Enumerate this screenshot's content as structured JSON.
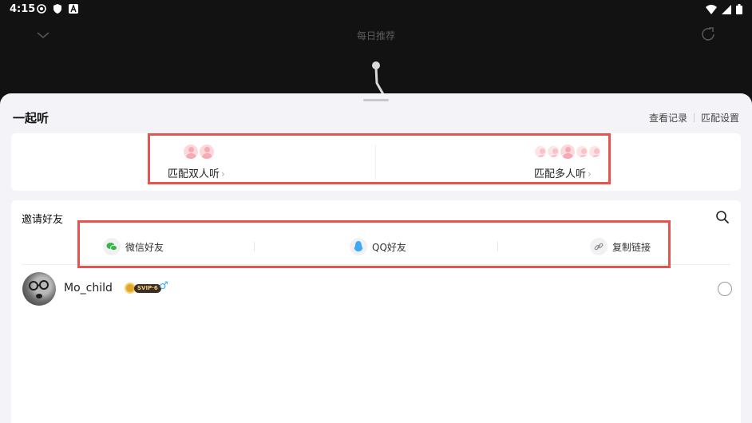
{
  "status_bar": {
    "time": "4:15"
  },
  "player_bar": {
    "title": "每日推荐"
  },
  "sheet": {
    "title": "一起听",
    "links": {
      "history": "查看记录",
      "settings": "匹配设置"
    }
  },
  "match": {
    "duo_label": "匹配双人听",
    "multi_label": "匹配多人听",
    "chevron": "›"
  },
  "invite": {
    "title": "邀请好友",
    "share_options": [
      {
        "label": "微信好友",
        "icon": "wechat-icon"
      },
      {
        "label": "QQ好友",
        "icon": "qq-icon"
      },
      {
        "label": "复制链接",
        "icon": "link-icon"
      }
    ],
    "friends": [
      {
        "name": "Mo_child",
        "vip_badge": "SVIP·6",
        "gender_symbol": "♂",
        "selected": false
      }
    ]
  },
  "colors": {
    "highlight": "#e8534f",
    "wechat": "#39b54a",
    "qq": "#3fa9f5",
    "sheet_bg": "#f4f4f8"
  }
}
